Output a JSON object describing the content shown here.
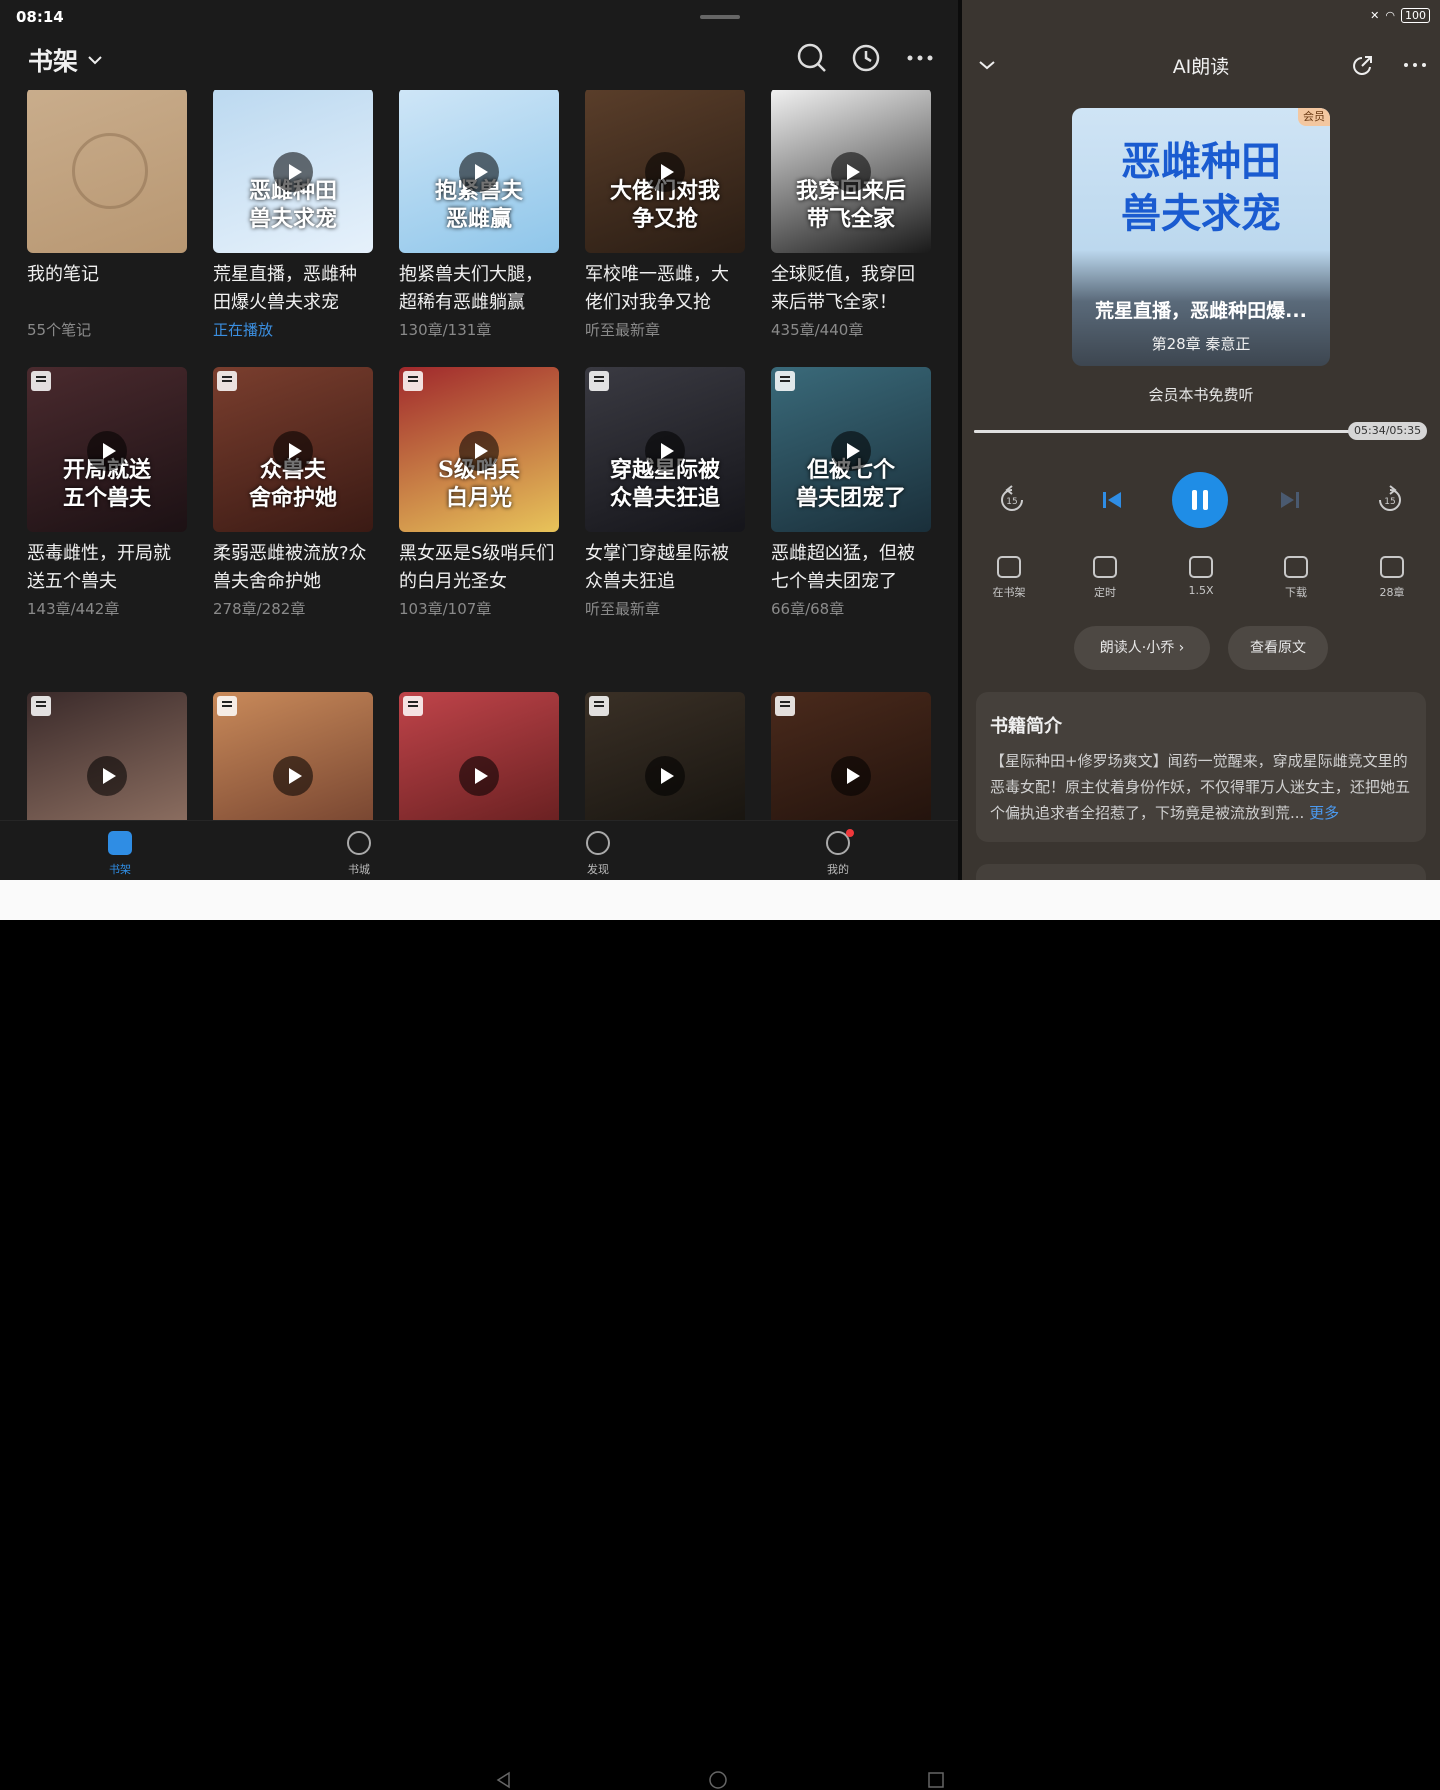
{
  "status": {
    "time": "08:14",
    "battery": "100"
  },
  "header": {
    "title": "书架"
  },
  "icons": {
    "search": "search-icon",
    "history": "history-icon",
    "more": "more-icon"
  },
  "books": [
    {
      "title": "我的笔记",
      "sub": "55个笔记",
      "cover_text": "",
      "color1": "#c9ad8c",
      "color2": "#b89772"
    },
    {
      "title": "荒星直播，恶雌种田爆火兽夫求宠",
      "sub": "正在播放",
      "cover_text": "恶雌种田\n兽夫求宠",
      "color1": "#bcd9f0",
      "color2": "#e6f1fb"
    },
    {
      "title": "抱紧兽夫们大腿，超稀有恶雌躺赢",
      "sub": "130章/131章",
      "cover_text": "抱紧兽夫\n恶雌赢",
      "color1": "#cfe6f7",
      "color2": "#8fc6ea"
    },
    {
      "title": "军校唯一恶雌，大佬们对我争又抢",
      "sub": "听至最新章",
      "cover_text": "大佬们对我\n争又抢",
      "color1": "#5a3e2a",
      "color2": "#2a1d14"
    },
    {
      "title": "全球贬值，我穿回来后带飞全家！",
      "sub": "435章/440章",
      "cover_text": "我穿回来后\n带飞全家",
      "color1": "#f2f2f2",
      "color2": "#1a1a1a"
    },
    {
      "title": "恶毒雌性，开局就送五个兽夫",
      "sub": "143章/442章",
      "cover_text": "开局就送\n五个兽夫",
      "color1": "#4a2a2e",
      "color2": "#1c1114"
    },
    {
      "title": "柔弱恶雌被流放?众兽夫舍命护她",
      "sub": "278章/282章",
      "cover_text": "众兽夫\n舍命护她",
      "color1": "#7a3e2e",
      "color2": "#3a1a14"
    },
    {
      "title": "黑女巫是S级哨兵们的白月光圣女",
      "sub": "103章/107章",
      "cover_text": "S级哨兵\n白月光",
      "color1": "#a0282c",
      "color2": "#e8c45a"
    },
    {
      "title": "女掌门穿越星际被众兽夫狂追",
      "sub": "听至最新章",
      "cover_text": "穿越星际被\n众兽夫狂追",
      "color1": "#3a3a42",
      "color2": "#15151a"
    },
    {
      "title": "恶雌超凶猛，但被七个兽夫团宠了",
      "sub": "66章/68章",
      "cover_text": "但被七个\n兽夫团宠了",
      "color1": "#3a6a7a",
      "color2": "#1a2f3a"
    },
    {
      "title": "",
      "sub": "",
      "cover_text": "",
      "color1": "#3a2a2a",
      "color2": "#9a7a6a"
    },
    {
      "title": "",
      "sub": "",
      "cover_text": "",
      "color1": "#c98a5a",
      "color2": "#6a3a2a"
    },
    {
      "title": "",
      "sub": "",
      "cover_text": "",
      "color1": "#c0444a",
      "color2": "#5a1a1a"
    },
    {
      "title": "",
      "sub": "",
      "cover_text": "",
      "color1": "#3a3026",
      "color2": "#12100c"
    },
    {
      "title": "",
      "sub": "",
      "cover_text": "",
      "color1": "#4a2a1c",
      "color2": "#1c0f0a"
    }
  ],
  "tabs": [
    {
      "label": "书架",
      "icon": "bookshelf-icon"
    },
    {
      "label": "书城",
      "icon": "store-icon"
    },
    {
      "label": "发现",
      "icon": "discover-icon"
    },
    {
      "label": "我的",
      "icon": "profile-icon"
    }
  ],
  "player": {
    "header_title": "AI朗读",
    "vip_badge": "会员",
    "cover_title": "恶雌种田\n兽夫求宠",
    "book_name": "荒星直播，恶雌种田爆...",
    "chapter": "第28章 秦意正",
    "free_note": "会员本书免费听",
    "time": "05:34/05:35",
    "progress": 0.997,
    "funcs": [
      {
        "label": "在书架",
        "icon": "bookshelf-icon"
      },
      {
        "label": "定时",
        "icon": "alarm-icon"
      },
      {
        "label": "1.5X",
        "icon": "speed-mic-icon"
      },
      {
        "label": "下载",
        "icon": "download-icon"
      },
      {
        "label": "28章",
        "icon": "chapter-list-icon"
      }
    ],
    "reader_btn": "朗读人·小乔 ›",
    "original_btn": "查看原文",
    "intro_title": "书籍简介",
    "intro_text": "【星际种田+修罗场爽文】闻药一觉醒来，穿成星际雌竞文里的恶毒女配！原主仗着身份作妖，不仅得罪万人迷女主，还把她五个偏执追求者全招惹了，下场竟是被流放到荒...",
    "intro_more": "更多"
  }
}
